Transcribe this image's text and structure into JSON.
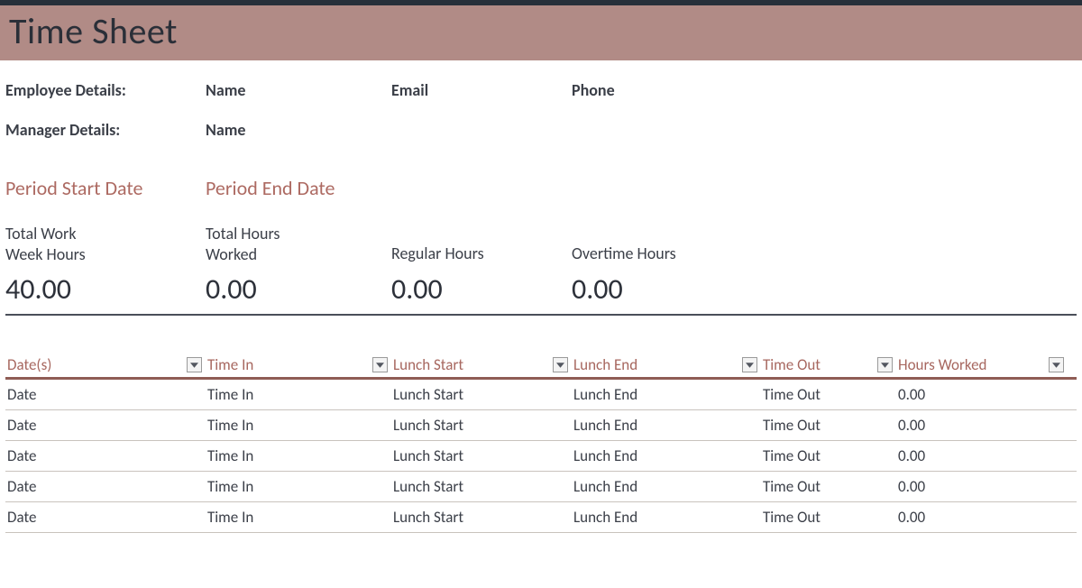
{
  "title": "Time Sheet",
  "employee": {
    "label": "Employee Details:",
    "name": "Name",
    "email": "Email",
    "phone": "Phone"
  },
  "manager": {
    "label": "Manager Details:",
    "name": "Name"
  },
  "period": {
    "start_label": "Period Start Date",
    "end_label": "Period End Date"
  },
  "summary": [
    {
      "label": "Total Work\nWeek Hours",
      "value": "40.00"
    },
    {
      "label": "Total Hours\nWorked",
      "value": "0.00"
    },
    {
      "label": "Regular Hours",
      "value": "0.00"
    },
    {
      "label": "Overtime Hours",
      "value": "0.00"
    }
  ],
  "table": {
    "headers": [
      "Date(s)",
      "Time In",
      "Lunch Start",
      "Lunch End",
      "Time Out",
      "Hours Worked"
    ],
    "rows": [
      {
        "date": "Date",
        "time_in": "Time In",
        "lunch_start": "Lunch Start",
        "lunch_end": "Lunch End",
        "time_out": "Time Out",
        "hours": "0.00"
      },
      {
        "date": "Date",
        "time_in": "Time In",
        "lunch_start": "Lunch Start",
        "lunch_end": "Lunch End",
        "time_out": "Time Out",
        "hours": "0.00"
      },
      {
        "date": "Date",
        "time_in": "Time In",
        "lunch_start": "Lunch Start",
        "lunch_end": "Lunch End",
        "time_out": "Time Out",
        "hours": "0.00"
      },
      {
        "date": "Date",
        "time_in": "Time In",
        "lunch_start": "Lunch Start",
        "lunch_end": "Lunch End",
        "time_out": "Time Out",
        "hours": "0.00"
      },
      {
        "date": "Date",
        "time_in": "Time In",
        "lunch_start": "Lunch Start",
        "lunch_end": "Lunch End",
        "time_out": "Time Out",
        "hours": "0.00"
      }
    ]
  }
}
